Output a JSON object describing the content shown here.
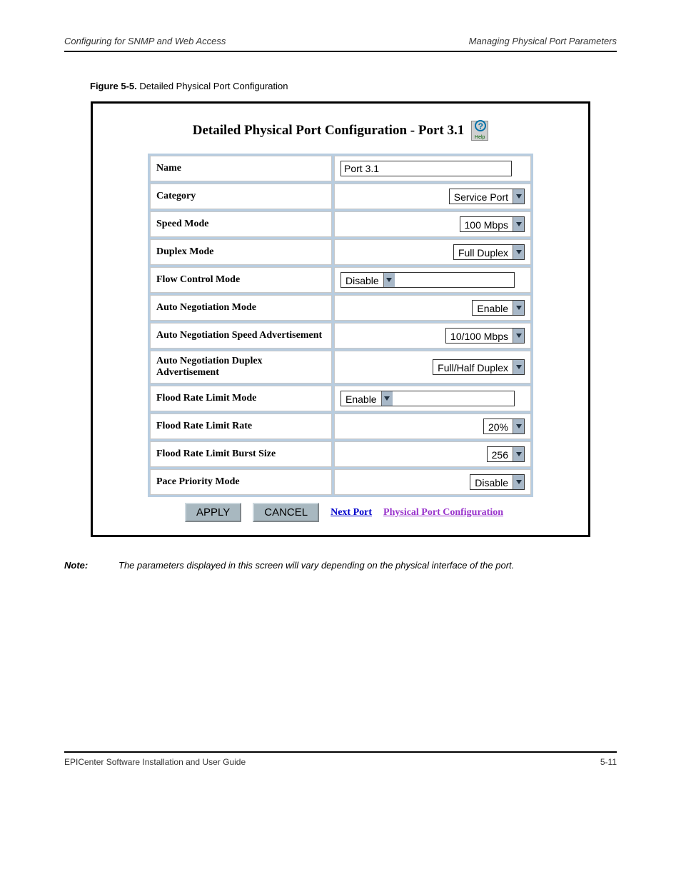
{
  "header": {
    "left": "Configuring for SNMP and Web Access",
    "right": "Managing Physical Port Parameters"
  },
  "caption": {
    "prefix": "Figure 5-5.",
    "text": "Detailed Physical Port Configuration"
  },
  "figure": {
    "title": "Detailed Physical Port Configuration - Port 3.1",
    "help_label": "Help"
  },
  "rows": [
    {
      "label": "Name",
      "type": "text",
      "value": "Port 3.1",
      "align": "left",
      "width": "full"
    },
    {
      "label": "Category",
      "type": "select",
      "value": "Service Port",
      "align": "right"
    },
    {
      "label": "Speed Mode",
      "type": "select",
      "value": "100 Mbps",
      "align": "right"
    },
    {
      "label": "Duplex Mode",
      "type": "select",
      "value": "Full Duplex",
      "align": "right"
    },
    {
      "label": "Flow Control Mode",
      "type": "select",
      "value": "Disable",
      "align": "left",
      "width": "full"
    },
    {
      "label": "Auto Negotiation Mode",
      "type": "select",
      "value": "Enable",
      "align": "right"
    },
    {
      "label": "Auto Negotiation Speed Advertisement",
      "type": "select",
      "value": "10/100 Mbps",
      "align": "right"
    },
    {
      "label": "Auto Negotiation Duplex Advertisement",
      "type": "select",
      "value": "Full/Half Duplex",
      "align": "right"
    },
    {
      "label": "Flood Rate Limit Mode",
      "type": "select",
      "value": "Enable",
      "align": "left",
      "width": "full"
    },
    {
      "label": "Flood Rate Limit Rate",
      "type": "select",
      "value": "20%",
      "align": "right"
    },
    {
      "label": "Flood Rate Limit Burst Size",
      "type": "select",
      "value": "256",
      "align": "right"
    },
    {
      "label": "Pace Priority Mode",
      "type": "select",
      "value": "Disable",
      "align": "right"
    }
  ],
  "buttons": {
    "apply": "APPLY",
    "cancel": "CANCEL",
    "next_port": "Next Port",
    "phys_config": "Physical Port Configuration"
  },
  "note": {
    "label": "Note:",
    "body": "The parameters displayed in this screen will vary depending on the physical interface of the port."
  },
  "footer": {
    "left": "EPICenter Software Installation and User Guide",
    "right": "5-11"
  }
}
